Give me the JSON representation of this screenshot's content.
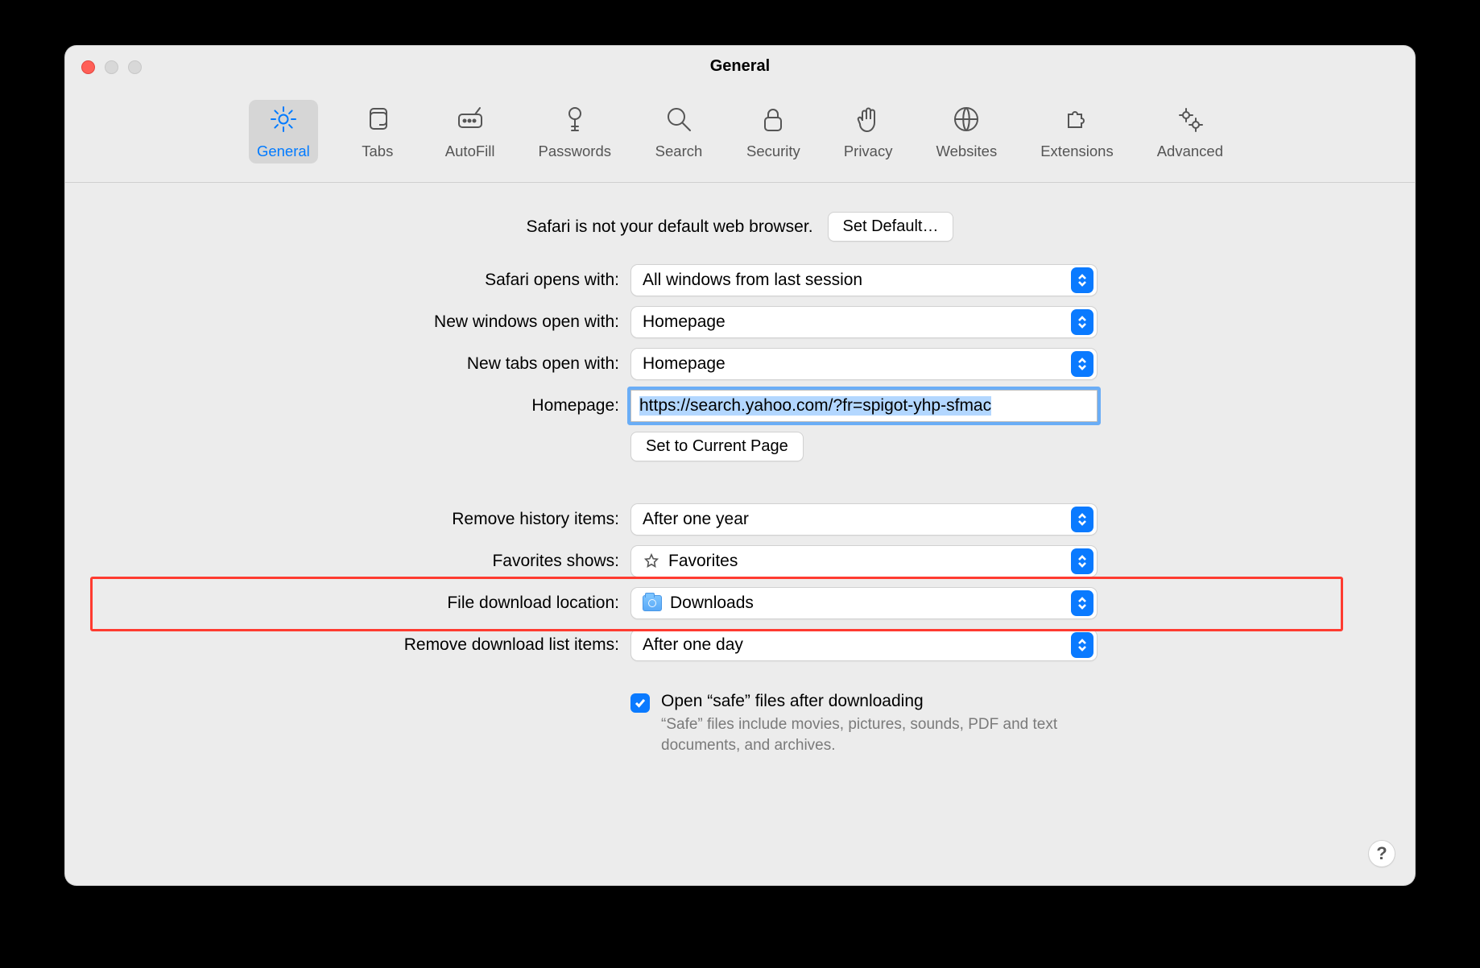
{
  "window": {
    "title": "General"
  },
  "tabs": [
    {
      "id": "general",
      "label": "General"
    },
    {
      "id": "tabs",
      "label": "Tabs"
    },
    {
      "id": "autofill",
      "label": "AutoFill"
    },
    {
      "id": "passwords",
      "label": "Passwords"
    },
    {
      "id": "search",
      "label": "Search"
    },
    {
      "id": "security",
      "label": "Security"
    },
    {
      "id": "privacy",
      "label": "Privacy"
    },
    {
      "id": "websites",
      "label": "Websites"
    },
    {
      "id": "extensions",
      "label": "Extensions"
    },
    {
      "id": "advanced",
      "label": "Advanced"
    }
  ],
  "banner": {
    "text": "Safari is not your default web browser.",
    "button": "Set Default…"
  },
  "labels": {
    "opens_with": "Safari opens with:",
    "new_windows": "New windows open with:",
    "new_tabs": "New tabs open with:",
    "homepage": "Homepage:",
    "set_current": "Set to Current Page",
    "remove_history": "Remove history items:",
    "favorites": "Favorites shows:",
    "download_loc": "File download location:",
    "remove_downloads": "Remove download list items:"
  },
  "values": {
    "opens_with": "All windows from last session",
    "new_windows": "Homepage",
    "new_tabs": "Homepage",
    "homepage": "https://search.yahoo.com/?fr=spigot-yhp-sfmac",
    "remove_history": "After one year",
    "favorites": "Favorites",
    "download_loc": "Downloads",
    "remove_downloads": "After one day"
  },
  "safe_files": {
    "label": "Open “safe” files after downloading",
    "note": "“Safe” files include movies, pictures, sounds, PDF and text documents, and archives.",
    "checked": true
  },
  "help": "?"
}
